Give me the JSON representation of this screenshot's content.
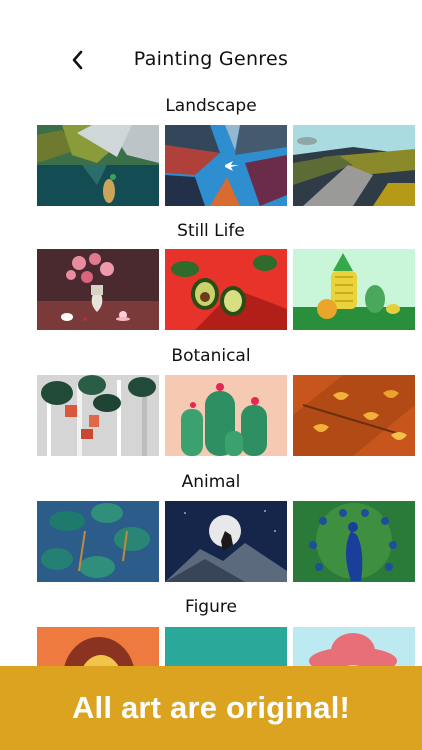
{
  "header": {
    "title": "Painting Genres"
  },
  "sections": [
    {
      "label": "Landscape"
    },
    {
      "label": "Still Life"
    },
    {
      "label": "Botanical"
    },
    {
      "label": "Animal"
    },
    {
      "label": "Figure"
    }
  ],
  "banner": {
    "text": "All art are original!"
  }
}
